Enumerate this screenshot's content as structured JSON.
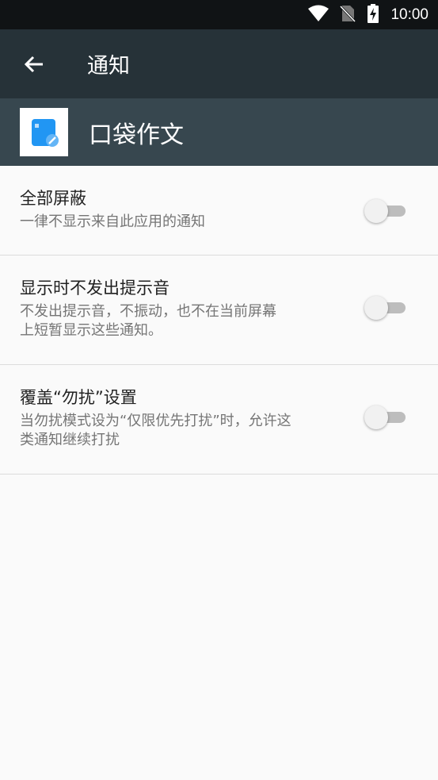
{
  "status_bar": {
    "time": "10:00",
    "icons": [
      "wifi-icon",
      "no-sim-icon",
      "battery-charging-icon"
    ]
  },
  "app_bar": {
    "back_icon": "arrow-left-icon",
    "title": "通知"
  },
  "app_header": {
    "icon": "pocket-essay-app-icon",
    "name": "口袋作文"
  },
  "settings": [
    {
      "title": "全部屏蔽",
      "summary": "一律不显示来自此应用的通知",
      "enabled": false
    },
    {
      "title": "显示时不发出提示音",
      "summary_lines": [
        "不发出提示音，不振动，也不在当前屏幕",
        "上短暂显示这些通知。"
      ],
      "enabled": false
    },
    {
      "title": "覆盖“勿扰”设置",
      "summary_lines": [
        "当勿扰模式设为“仅限优先打扰”时，允许这",
        "类通知继续打扰"
      ],
      "enabled": false
    }
  ],
  "colors": {
    "status_bar": "#101315",
    "app_bar": "#263238",
    "app_header": "#37474f",
    "background": "#fafafa",
    "accent_icon": "#2196f3"
  }
}
